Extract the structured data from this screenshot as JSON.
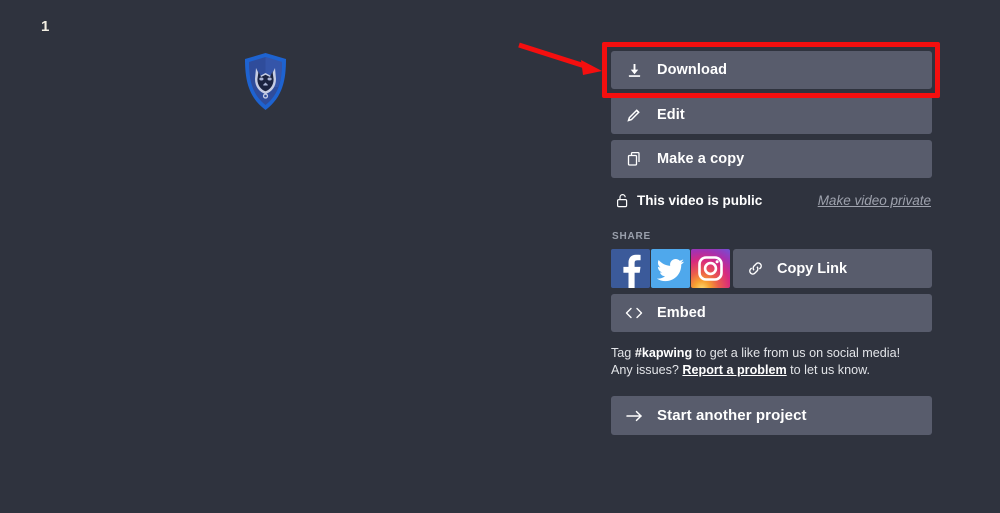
{
  "theme": {
    "background": "#2f333e",
    "button_fill": "#585c6c",
    "accent_annotation": "#f40f0f",
    "muted_text": "#9ea2ad"
  },
  "preview": {
    "slide_number": "1",
    "logo_name": "wolf-shield-logo",
    "logo_colors": {
      "shield_outer": "#1e63d0",
      "shield_inner": "#2f4c9b",
      "emblem": "#c9cfe6"
    }
  },
  "actions": {
    "download": {
      "label": "Download",
      "icon": "download-icon"
    },
    "edit": {
      "label": "Edit",
      "icon": "pencil-icon"
    },
    "make_copy": {
      "label": "Make a copy",
      "icon": "copy-icon"
    }
  },
  "visibility": {
    "icon": "unlocked-padlock-icon",
    "status_text": "This video is public",
    "toggle_link": "Make video private"
  },
  "share": {
    "section_label": "SHARE",
    "social": [
      {
        "name": "facebook",
        "glyph": "f",
        "color": "#3b5a9a"
      },
      {
        "name": "twitter",
        "glyph": "bird",
        "color": "#4fa8ec"
      },
      {
        "name": "instagram",
        "glyph": "camera",
        "color": "#d92a7d"
      }
    ],
    "copy_link": {
      "label": "Copy Link",
      "icon": "chain-link-icon"
    },
    "embed": {
      "label": "Embed",
      "icon": "code-brackets-icon"
    }
  },
  "footnote": {
    "prefix": "Tag ",
    "hashtag": "#kapwing",
    "middle": " to get a like from us on social media! Any issues? ",
    "report_link": "Report a problem",
    "suffix": " to let us know."
  },
  "start_another": {
    "label": "Start another project",
    "icon": "arrow-right-icon"
  },
  "annotation": {
    "highlight_target": "download-button",
    "arrow_color": "#f40f0f",
    "box_color": "#f40f0f"
  }
}
